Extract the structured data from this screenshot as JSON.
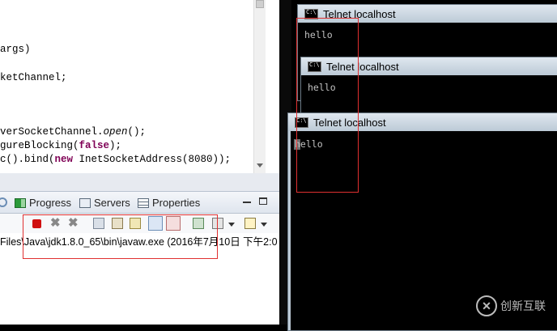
{
  "editor": {
    "lines": [
      {
        "text": "args)"
      },
      {
        "text": "ketChannel;"
      },
      {
        "pre": "verSocketChannel.",
        "ital": "open",
        "post": "();"
      },
      {
        "pre": "gureBlocking(",
        "kw": "false",
        "post": ");"
      },
      {
        "pre": "c().bind(",
        "kw": "new",
        "post": " InetSocketAddress(8080));"
      }
    ]
  },
  "views": {
    "tabs": [
      {
        "label": "Progress"
      },
      {
        "label": "Servers"
      },
      {
        "label": "Properties"
      }
    ]
  },
  "console": {
    "launch_line": "Files\\Java\\jdk1.8.0_65\\bin\\javaw.exe (2016年7月10日 下午2:0"
  },
  "telnet_windows": [
    {
      "title": "Telnet localhost",
      "output": "hello"
    },
    {
      "title": "Telnet localhost",
      "output": "hello"
    },
    {
      "title": "Telnet localhost",
      "output": "hello"
    }
  ],
  "watermark": {
    "text": "创新互联"
  },
  "colors": {
    "annotation_red": "#e03030",
    "keyword": "#7f0055",
    "terminal_bg": "#000000"
  }
}
